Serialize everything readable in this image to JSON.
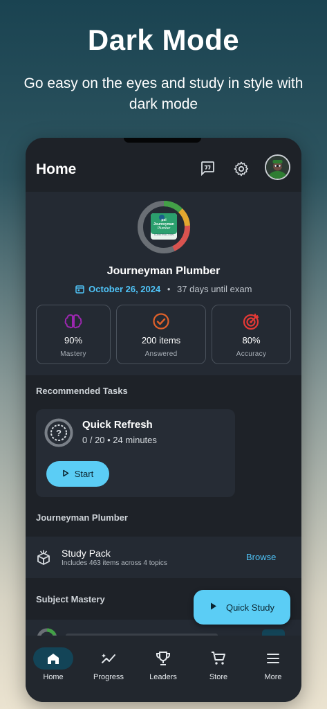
{
  "promo": {
    "title": "Dark Mode",
    "subtitle": "Go easy on the eyes and study in style with dark mode"
  },
  "appbar": {
    "title": "Home",
    "icons": [
      "feedback-icon",
      "settings-icon",
      "avatar"
    ]
  },
  "exam": {
    "name": "Journeyman Plumber",
    "badge_line1": "psi",
    "badge_line2": "Journeyman",
    "badge_line3": "Plumber",
    "badge_line4": "CONSTRUCTION",
    "date": "October 26, 2024",
    "separator": "•",
    "days_until": "37 days until exam"
  },
  "stats": [
    {
      "value": "90%",
      "label": "Mastery",
      "icon": "brain-icon",
      "color": "#9c27b0"
    },
    {
      "value": "200 items",
      "label": "Answered",
      "icon": "check-circle-icon",
      "color": "#e0612a"
    },
    {
      "value": "80%",
      "label": "Accuracy",
      "icon": "target-icon",
      "color": "#e53935"
    }
  ],
  "recommended": {
    "heading": "Recommended Tasks",
    "task_title": "Quick Refresh",
    "task_meta": "0 / 20 • 24 minutes",
    "start_label": "Start"
  },
  "pack_section": {
    "heading": "Journeyman Plumber",
    "title": "Study Pack",
    "subtitle": "Includes 463 items across 4 topics",
    "browse_label": "Browse"
  },
  "mastery": {
    "heading": "Subject Mastery"
  },
  "fab": {
    "label": "Quick Study"
  },
  "nav": [
    {
      "label": "Home",
      "icon": "home-icon",
      "active": true
    },
    {
      "label": "Progress",
      "icon": "progress-icon",
      "active": false
    },
    {
      "label": "Leaders",
      "icon": "trophy-icon",
      "active": false
    },
    {
      "label": "Store",
      "icon": "cart-icon",
      "active": false
    },
    {
      "label": "More",
      "icon": "menu-icon",
      "active": false
    }
  ],
  "colors": {
    "accent": "#5bcdf5",
    "link": "#4fc3f7",
    "surface": "#1e2228",
    "card": "#242a33",
    "nav_active": "#134457"
  }
}
